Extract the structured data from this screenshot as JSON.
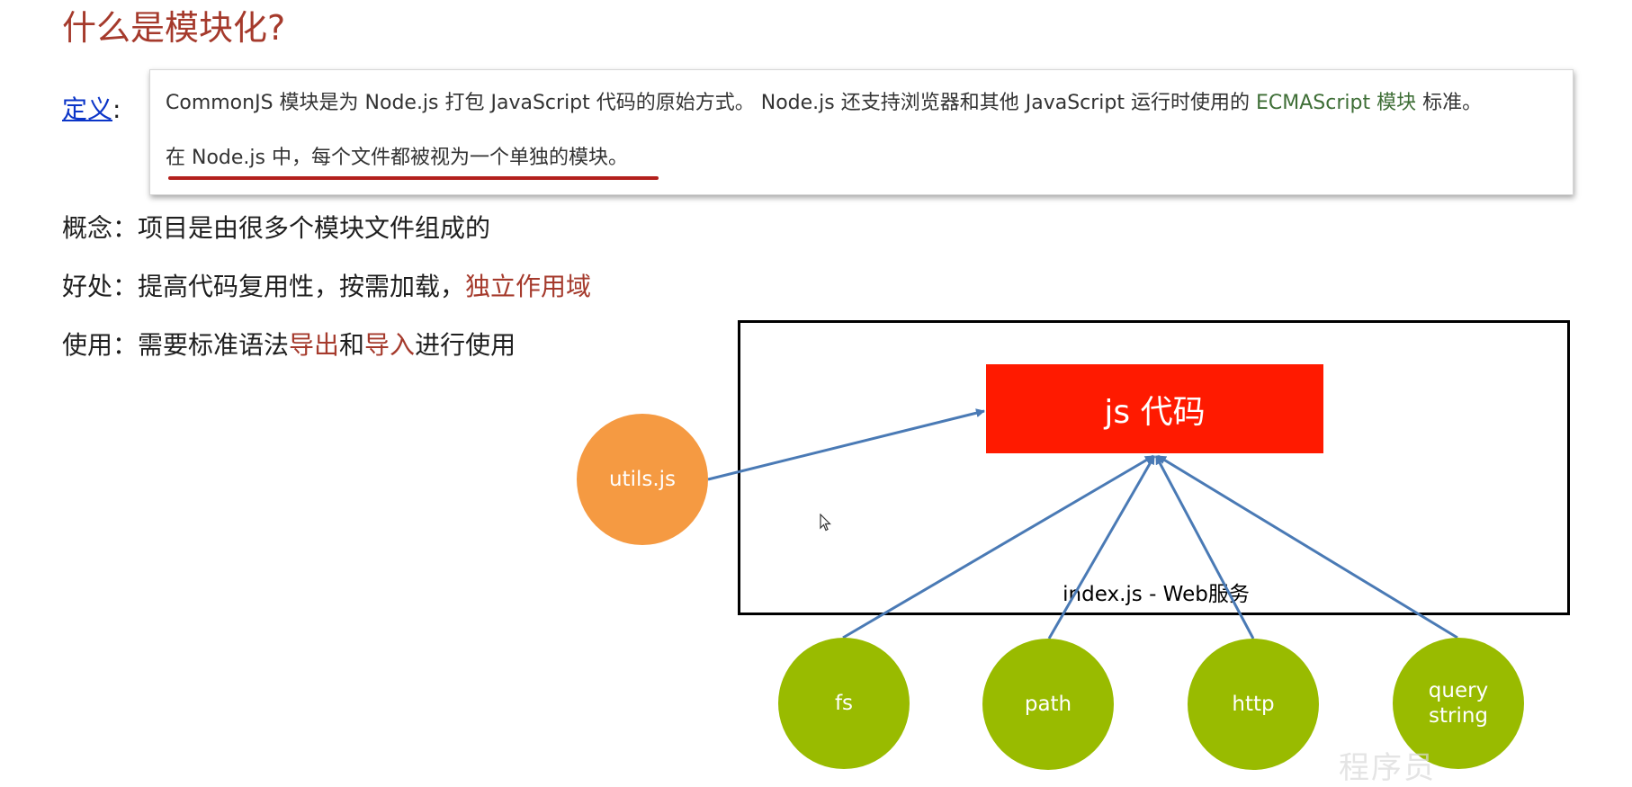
{
  "title": "什么是模块化?",
  "definition": {
    "label": "定义",
    "colon": ":",
    "line1_part1": "CommonJS 模块是为 Node.js 打包 JavaScript 代码的原始方式。 Node.js 还支持浏览器和其他 JavaScript 运行时使用的 ",
    "line1_link": "ECMAScript 模块",
    "line1_part2": " 标准。",
    "line2": "在 Node.js 中，每个文件都被视为一个单独的模块。"
  },
  "bullets": {
    "concept": "概念：项目是由很多个模块文件组成的",
    "benefit_prefix": "好处：提高代码复用性，按需加载，",
    "benefit_red": "独立作用域",
    "usage_prefix": "使用：需要标准语法",
    "usage_red1": "导出",
    "usage_mid": "和",
    "usage_red2": "导入",
    "usage_suffix": "进行使用"
  },
  "diagram": {
    "main_box": "js 代码",
    "frame_label": "index.js - Web服务",
    "external_module": "utils.js",
    "builtin_modules": [
      "fs",
      "path",
      "http",
      "query string"
    ]
  },
  "colors": {
    "title": "#a53a2c",
    "link": "#0b35c8",
    "ecma": "#3e6e36",
    "underline": "#b3201c",
    "js_box": "#ff1a00",
    "utils_circle": "#f59a42",
    "module_circle": "#99bb00",
    "arrow": "#4a7ab5"
  },
  "watermark": "程序员"
}
